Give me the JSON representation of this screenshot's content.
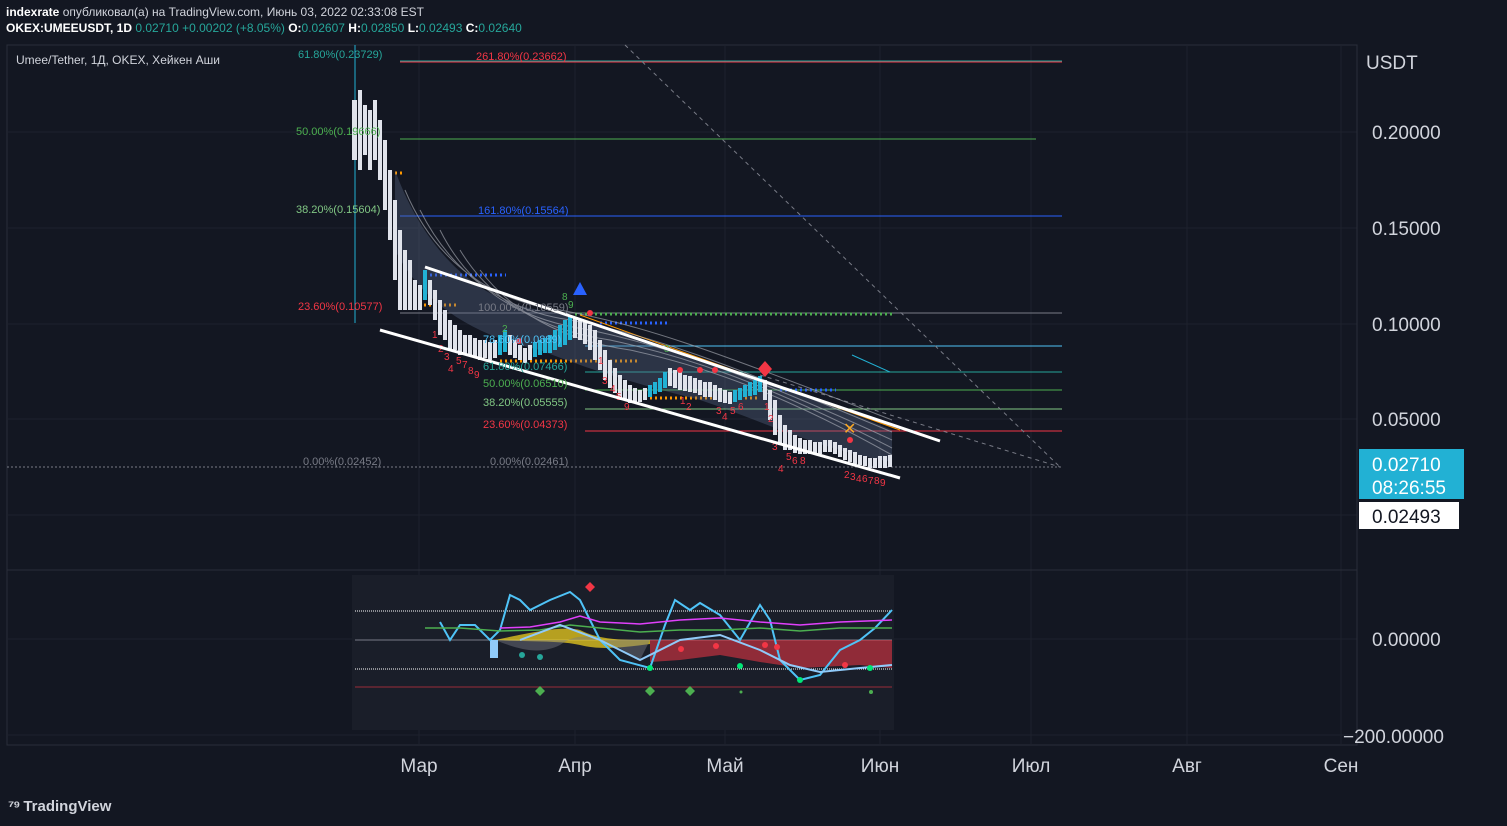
{
  "header": {
    "author": "indexrate",
    "published_text": "опубликовал(а) на TradingView.com, Июнь 03, 2022 02:33:08 EST",
    "symbol": "OKEX:UMEEUSDT, 1D",
    "last": "0.02710",
    "change": "+0.00202 (+8.05%)",
    "o_label": "O:",
    "o_val": "0.02607",
    "h_label": "H:",
    "h_val": "0.02850",
    "l_label": "L:",
    "l_val": "0.02493",
    "c_label": "C:",
    "c_val": "0.02640"
  },
  "chart_title": "Umee/Tether, 1Д, OKEX, Хейкен Аши",
  "price_axis": {
    "currency": "USDT",
    "ticks": [
      "0.20000",
      "0.15000",
      "0.10000",
      "0.05000",
      "0.00000",
      "−200.00000"
    ],
    "last_price": "0.02710",
    "countdown": "08:26:55",
    "low_marker": "0.02493"
  },
  "time_axis": [
    "Мар",
    "Апр",
    "Май",
    "Июн",
    "Июл",
    "Авг",
    "Сен"
  ],
  "fib_left": [
    "61.80%(0.23729)",
    "50.00%(0.19666)",
    "38.20%(0.15604)",
    "23.60%(0.10577)",
    "0.00%(0.02452)"
  ],
  "fib_ext": [
    "261.80%(0.23662)",
    "161.80%(0.15564)",
    "100.00%(0.10559)",
    "78.60%(0.0889)",
    "61.80%(0.07466)",
    "50.00%(0.06510)",
    "38.20%(0.05555)",
    "23.60%(0.04373)",
    "0.00%(0.02461)"
  ],
  "branding": "TradingView",
  "colors": {
    "background": "#131722",
    "grid": "#1e222d",
    "last_price_bg": "#22b1d4",
    "fib_618": "#26a69a",
    "fib_50": "#4caf50",
    "fib_382": "#81c784",
    "fib_236": "#f23645",
    "fib_1618": "#2962ff"
  }
}
